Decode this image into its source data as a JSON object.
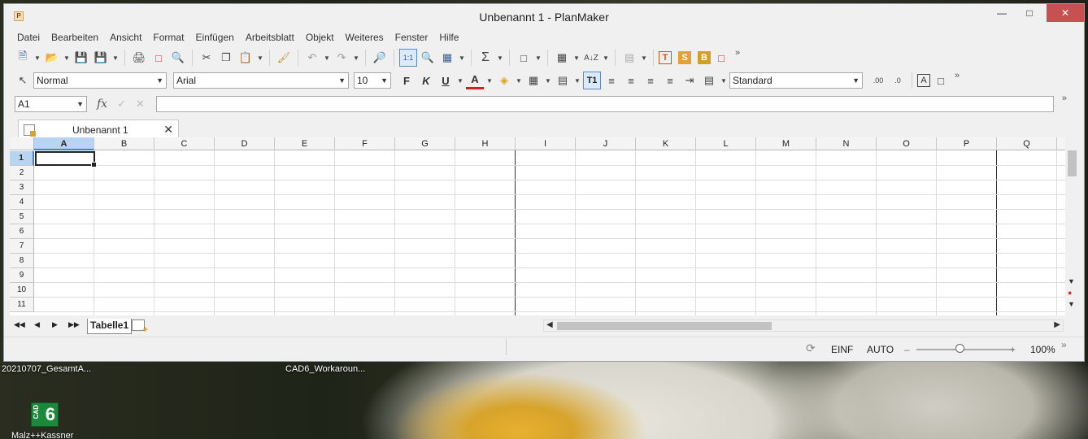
{
  "window": {
    "title": "Unbenannt 1 - PlanMaker",
    "app_icon": "P"
  },
  "menu": [
    "Datei",
    "Bearbeiten",
    "Ansicht",
    "Format",
    "Einfügen",
    "Arbeitsblatt",
    "Objekt",
    "Weiteres",
    "Fenster",
    "Hilfe"
  ],
  "format_bar": {
    "style": "Normal",
    "font": "Arial",
    "size": "10",
    "bold": "F",
    "italic": "K",
    "underline": "U",
    "text_color": "A",
    "number_format": "Standard"
  },
  "formula_bar": {
    "cell_ref": "A1",
    "fx": "fx"
  },
  "document_tab": {
    "name": "Unbenannt 1"
  },
  "columns": [
    "A",
    "B",
    "C",
    "D",
    "E",
    "F",
    "G",
    "H",
    "I",
    "J",
    "K",
    "L",
    "M",
    "N",
    "O",
    "P",
    "Q"
  ],
  "rows": [
    "1",
    "2",
    "3",
    "4",
    "5",
    "6",
    "7",
    "8",
    "9",
    "10",
    "11"
  ],
  "sheet_tabs": [
    "Tabelle1"
  ],
  "status": {
    "mode": "EINF",
    "calc": "AUTO",
    "zoom": "100%",
    "zoom_minus": "–",
    "zoom_plus": "+"
  },
  "desktop": {
    "label1": "20210707_GesamtA...",
    "label2": "CAD6_Workaroun...",
    "label3": "Malz++Kassner",
    "icon_text": "6",
    "icon_side": "CAD"
  }
}
